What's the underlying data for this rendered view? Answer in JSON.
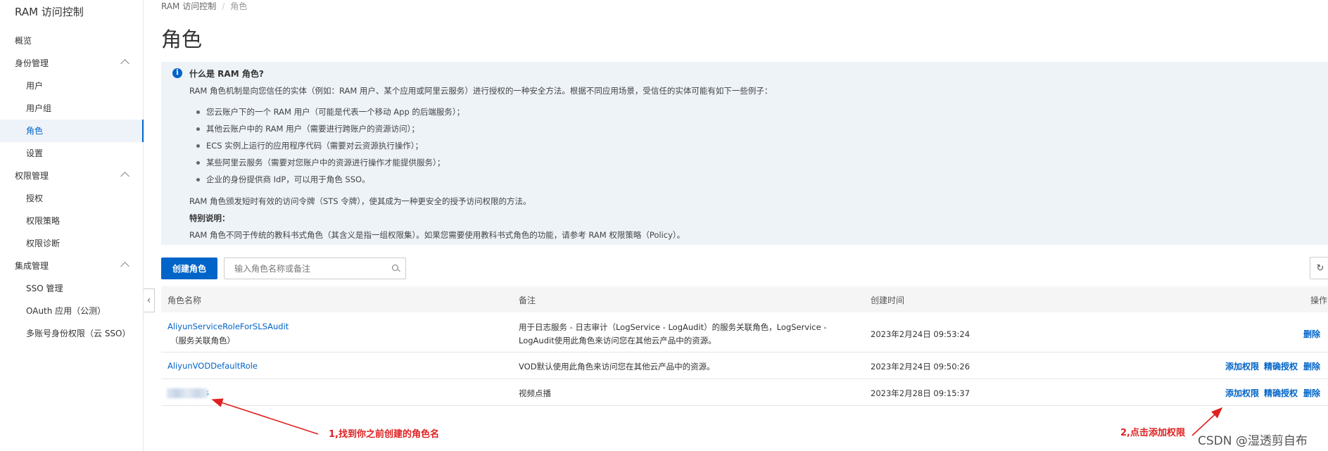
{
  "sidebar": {
    "title": "RAM 访问控制",
    "items": [
      {
        "label": "概览",
        "level": "top"
      },
      {
        "label": "身份管理",
        "level": "group"
      },
      {
        "label": "用户",
        "level": "sub"
      },
      {
        "label": "用户组",
        "level": "sub"
      },
      {
        "label": "角色",
        "level": "sub",
        "active": true
      },
      {
        "label": "设置",
        "level": "sub"
      },
      {
        "label": "权限管理",
        "level": "group"
      },
      {
        "label": "授权",
        "level": "sub"
      },
      {
        "label": "权限策略",
        "level": "sub"
      },
      {
        "label": "权限诊断",
        "level": "sub"
      },
      {
        "label": "集成管理",
        "level": "group"
      },
      {
        "label": "SSO 管理",
        "level": "sub"
      },
      {
        "label": "OAuth 应用（公测）",
        "level": "sub"
      },
      {
        "label": "多账号身份权限（云 SSO）",
        "level": "sub"
      }
    ],
    "collapse_glyph": "‹"
  },
  "breadcrumb": {
    "root": "RAM 访问控制",
    "separator": "/",
    "current": "角色"
  },
  "page_title": "角色",
  "info": {
    "icon": "info-icon",
    "icon_glyph": "i",
    "title": "什么是 RAM 角色?",
    "intro": "RAM 角色机制是向您信任的实体（例如：RAM 用户、某个应用或阿里云服务）进行授权的一种安全方法。根据不同应用场景，受信任的实体可能有如下一些例子：",
    "examples": [
      "您云账户下的一个 RAM 用户（可能是代表一个移动 App 的后端服务）；",
      "其他云账户中的 RAM 用户（需要进行跨账户的资源访问）；",
      "ECS 实例上运行的应用程序代码（需要对云资源执行操作）；",
      "某些阿里云服务（需要对您账户中的资源进行操作才能提供服务）；",
      "企业的身份提供商 IdP，可以用于角色 SSO。"
    ],
    "sts_note": "RAM 角色颁发短时有效的访问令牌（STS 令牌），使其成为一种更安全的授予访问权限的方法。",
    "special_title": "特别说明：",
    "special_text": "RAM 角色不同于传统的教科书式角色（其含义是指一组权限集）。如果您需要使用教科书式角色的功能，请参考 RAM 权限策略（Policy）。"
  },
  "toolbar": {
    "create_label": "创建角色",
    "search_placeholder": "输入角色名称或备注",
    "refresh_glyph": "↻"
  },
  "table": {
    "headers": {
      "name": "角色名称",
      "note": "备注",
      "created": "创建时间",
      "actions": "操作"
    },
    "rows": [
      {
        "name": "AliyunServiceRoleForSLSAudit",
        "name_sub": "（服务关联角色）",
        "note_line1": "用于日志服务 - 日志审计（LogService - LogAudit）的服务关联角色，LogService -",
        "note_line2": "LogAudit使用此角色来访问您在其他云产品中的资源。",
        "created": "2023年2月24日 09:53:24",
        "actions": [
          "删除"
        ]
      },
      {
        "name": "AliyunVODDefaultRole",
        "note_line1": "VOD默认使用此角色来访问您在其他云产品中的资源。",
        "created": "2023年2月24日 09:50:26",
        "actions": [
          "添加权限",
          "精确授权",
          "删除"
        ]
      },
      {
        "name": "ss",
        "note_line1": "视频点播",
        "created": "2023年2月28日 09:15:37",
        "actions": [
          "添加权限",
          "精确授权",
          "删除"
        ]
      }
    ]
  },
  "annotations": {
    "step1": "1,找到你之前创建的角色名",
    "step2": "2,点击添加权限",
    "color": "#e02020"
  },
  "watermark": "CSDN @湿透剪自布",
  "colors": {
    "accent": "#0064c8",
    "info_bg": "#eef3f8",
    "annotation": "#e02020"
  }
}
